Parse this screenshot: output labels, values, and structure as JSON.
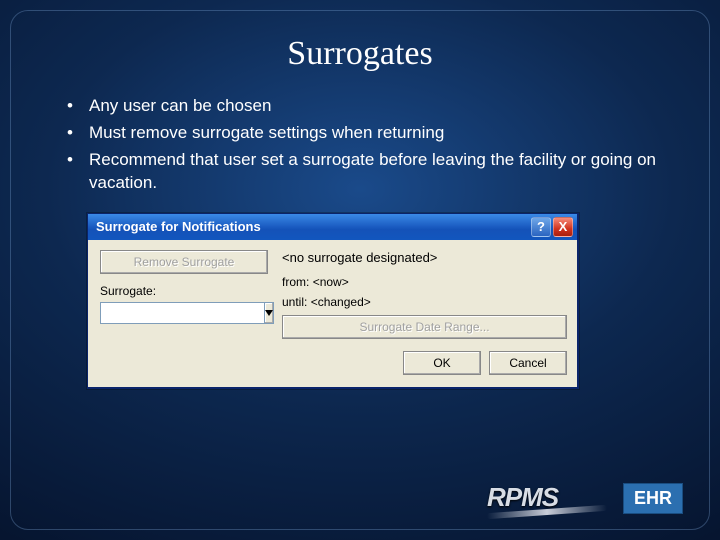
{
  "slide": {
    "title": "Surrogates",
    "bullets": [
      "Any user can be chosen",
      "Must remove surrogate settings when returning",
      "Recommend that user set a surrogate before leaving the facility or going on vacation."
    ]
  },
  "dialog": {
    "title": "Surrogate for Notifications",
    "remove_button_label": "Remove Surrogate",
    "surrogate_label": "Surrogate:",
    "surrogate_value": "",
    "status_text": "<no surrogate designated>",
    "from_label": "from:",
    "from_value": "<now>",
    "until_label": "until:",
    "until_value": "<changed>",
    "date_range_button_label": "Surrogate Date Range...",
    "ok_label": "OK",
    "cancel_label": "Cancel"
  },
  "branding": {
    "rpms": "RPMS",
    "ehr": "EHR"
  }
}
